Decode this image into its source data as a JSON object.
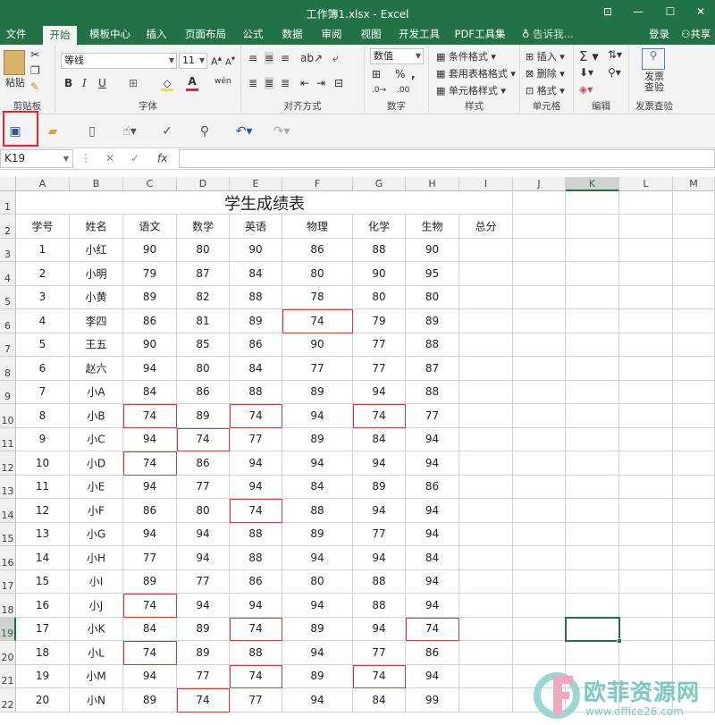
{
  "window": {
    "title": "工作簿1.xlsx - Excel",
    "controls": [
      "⊡",
      "—",
      "☐",
      "✕"
    ]
  },
  "tabs": [
    "文件",
    "开始",
    "模板中心",
    "插入",
    "页面布局",
    "公式",
    "数据",
    "审阅",
    "视图",
    "开发工具",
    "PDF工具集"
  ],
  "tell_me": "告诉我...",
  "login": "登录",
  "share": "共享",
  "ribbon": {
    "clipboard": {
      "paste": "粘贴",
      "label": "剪贴板"
    },
    "font": {
      "name": "等线",
      "size": "11",
      "bold": "B",
      "italic": "I",
      "underline": "U",
      "label": "字体"
    },
    "alignment": {
      "label": "对齐方式"
    },
    "number": {
      "format": "数值",
      "label": "数字"
    },
    "styles": {
      "conditional": "条件格式",
      "table": "套用表格格式",
      "cell": "单元格样式",
      "label": "样式"
    },
    "cells": {
      "insert": "插入",
      "delete": "删除",
      "format": "格式",
      "label": "单元格"
    },
    "editing": {
      "label": "编辑"
    },
    "invoice": {
      "check": "发票查验",
      "label": "发票查验"
    }
  },
  "formula_bar": {
    "name_box": "K19",
    "fx": "fx",
    "content": ""
  },
  "columns": [
    "A",
    "B",
    "C",
    "D",
    "E",
    "F",
    "G",
    "H",
    "I",
    "J",
    "K",
    "L",
    "M"
  ],
  "selected_cell": "K19",
  "sheet": {
    "title": "学生成绩表",
    "headers": [
      "学号",
      "姓名",
      "语文",
      "数学",
      "英语",
      "物理",
      "化学",
      "生物",
      "总分"
    ],
    "rows": [
      [
        "1",
        "小红",
        "90",
        "80",
        "90",
        "86",
        "88",
        "90"
      ],
      [
        "2",
        "小明",
        "79",
        "87",
        "84",
        "80",
        "90",
        "95"
      ],
      [
        "3",
        "小黄",
        "89",
        "82",
        "88",
        "78",
        "80",
        "80"
      ],
      [
        "4",
        "李四",
        "86",
        "81",
        "89",
        "74",
        "79",
        "89"
      ],
      [
        "5",
        "王五",
        "90",
        "85",
        "86",
        "90",
        "77",
        "88"
      ],
      [
        "6",
        "赵六",
        "94",
        "80",
        "84",
        "77",
        "77",
        "87"
      ],
      [
        "7",
        "小A",
        "84",
        "86",
        "88",
        "89",
        "94",
        "88"
      ],
      [
        "8",
        "小B",
        "74",
        "89",
        "74",
        "94",
        "74",
        "77"
      ],
      [
        "9",
        "小C",
        "94",
        "74",
        "77",
        "89",
        "84",
        "94"
      ],
      [
        "10",
        "小D",
        "74",
        "86",
        "94",
        "94",
        "94",
        "94"
      ],
      [
        "11",
        "小E",
        "94",
        "77",
        "94",
        "84",
        "89",
        "86"
      ],
      [
        "12",
        "小F",
        "86",
        "80",
        "74",
        "88",
        "94",
        "94"
      ],
      [
        "13",
        "小G",
        "94",
        "94",
        "88",
        "89",
        "77",
        "94"
      ],
      [
        "14",
        "小H",
        "77",
        "94",
        "88",
        "94",
        "94",
        "84"
      ],
      [
        "15",
        "小I",
        "89",
        "77",
        "86",
        "80",
        "88",
        "94"
      ],
      [
        "16",
        "小J",
        "74",
        "94",
        "94",
        "94",
        "88",
        "94"
      ],
      [
        "17",
        "小K",
        "84",
        "89",
        "74",
        "89",
        "94",
        "74"
      ],
      [
        "18",
        "小L",
        "74",
        "89",
        "88",
        "94",
        "77",
        "86"
      ],
      [
        "19",
        "小M",
        "94",
        "77",
        "74",
        "89",
        "74",
        "94"
      ],
      [
        "20",
        "小N",
        "89",
        "74",
        "77",
        "94",
        "84",
        "99"
      ]
    ],
    "highlight_value": "74"
  },
  "watermark": {
    "text": "欧菲资源网",
    "url": "www.office26.com"
  },
  "colors": {
    "excel_green": "#217346",
    "highlight_red": "#d23b3b",
    "watermark": "#7cc8c2"
  }
}
